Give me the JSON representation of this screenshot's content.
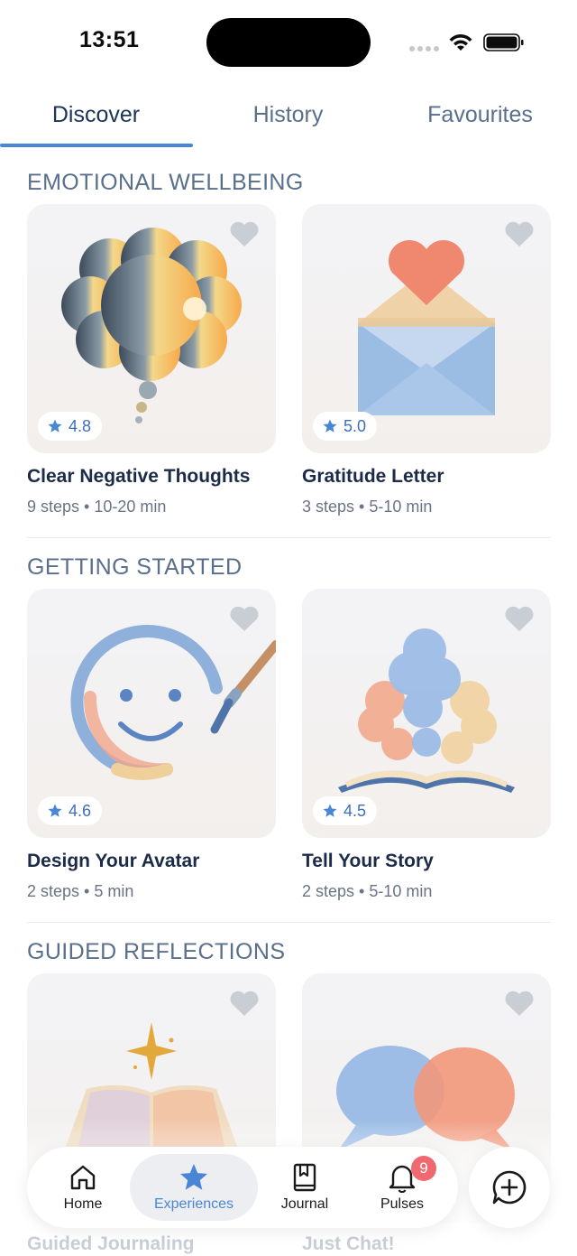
{
  "status_bar": {
    "time": "13:51"
  },
  "tabs": [
    {
      "label": "Discover",
      "active": true
    },
    {
      "label": "History",
      "active": false
    },
    {
      "label": "Favourites",
      "active": false
    }
  ],
  "sections": [
    {
      "title": "EMOTIONAL WELLBEING",
      "cards": [
        {
          "title": "Clear Negative Thoughts",
          "meta": "9 steps • 10-20 min",
          "rating": "4.8",
          "art": "thought-cloud"
        },
        {
          "title": "Gratitude Letter",
          "meta": "3 steps • 5-10 min",
          "rating": "5.0",
          "art": "heart-envelope"
        }
      ]
    },
    {
      "title": "GETTING STARTED",
      "cards": [
        {
          "title": "Design Your Avatar",
          "meta": "2 steps • 5 min",
          "rating": "4.6",
          "art": "smiley-paintbrush"
        },
        {
          "title": "Tell Your Story",
          "meta": "2 steps • 5-10 min",
          "rating": "4.5",
          "art": "book-smoke"
        }
      ]
    },
    {
      "title": "GUIDED REFLECTIONS",
      "cards": [
        {
          "title": "Guided Journaling",
          "art": "sparkle-book"
        },
        {
          "title": "Just Chat!",
          "art": "speech-bubbles"
        }
      ]
    }
  ],
  "bottom_nav": {
    "items": [
      {
        "label": "Home",
        "icon": "home-icon",
        "active": false
      },
      {
        "label": "Experiences",
        "icon": "star-icon",
        "active": true
      },
      {
        "label": "Journal",
        "icon": "journal-icon",
        "active": false
      },
      {
        "label": "Pulses",
        "icon": "bell-icon",
        "active": false,
        "badge": "9"
      }
    ],
    "fab_icon": "chat-plus-icon"
  },
  "colors": {
    "accent": "#4a86d6",
    "text_primary": "#1c2b48",
    "text_secondary": "#5a6f8c",
    "badge": "#f06870",
    "favourite_heart": "#c9cdd4"
  }
}
